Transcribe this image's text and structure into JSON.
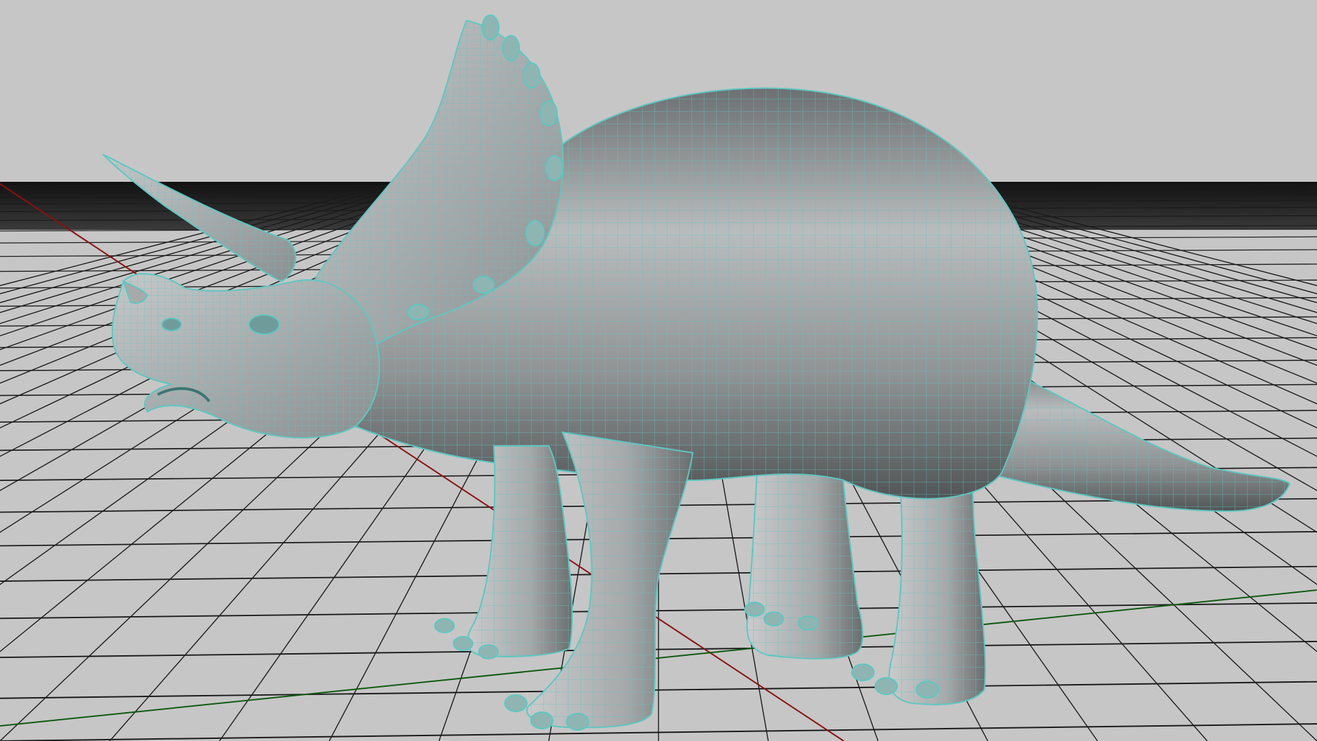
{
  "viewport": {
    "scene": "3d-viewport",
    "shading": "smooth-shaded-with-wireframe",
    "subject": "triceratops-model",
    "colors": {
      "background": "#c6c6c6",
      "grid_line": "#1a1a1a",
      "axis_x": "#8a1010",
      "axis_z": "#0f5a0f",
      "mesh_body": "#9ea0a1",
      "wireframe": "#5fc6c2"
    }
  }
}
